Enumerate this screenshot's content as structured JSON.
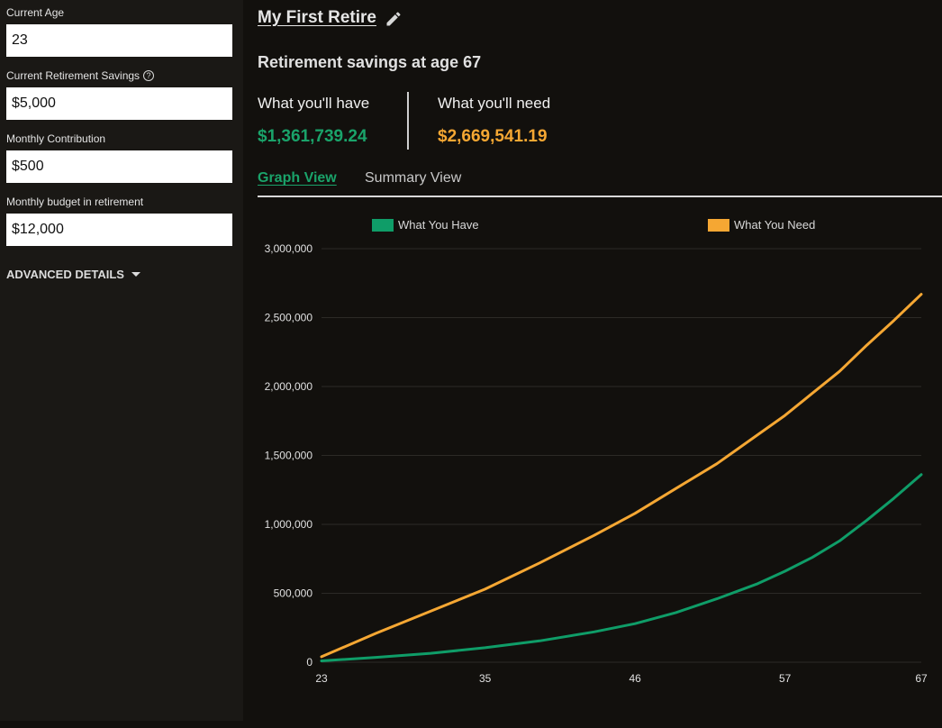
{
  "sidebar": {
    "fields": [
      {
        "label": "Current Age",
        "value": "23"
      },
      {
        "label": "Current Retirement Savings",
        "value": "$5,000",
        "help_icon": "question-circle-icon"
      },
      {
        "label": "Monthly Contribution",
        "value": "$500"
      },
      {
        "label": "Monthly budget in retirement",
        "value": "$12,000"
      }
    ],
    "advanced_label": "ADVANCED DETAILS"
  },
  "header": {
    "plan_name": "My First Retire",
    "edit_icon": "pencil-icon"
  },
  "summary": {
    "title": "Retirement savings at age 67",
    "have_label": "What you'll have",
    "have_value": "$1,361,739.24",
    "need_label": "What you'll need",
    "need_value": "$2,669,541.19"
  },
  "tabs": [
    {
      "label": "Graph View",
      "active": true
    },
    {
      "label": "Summary View",
      "active": false
    }
  ],
  "colors": {
    "have": "#0f9d68",
    "need": "#f5a733",
    "background": "#12100d"
  },
  "chart_data": {
    "type": "line",
    "x_ticks": [
      23,
      35,
      46,
      57,
      67
    ],
    "y_ticks": [
      "0",
      "500,000",
      "1,000,000",
      "1,500,000",
      "2,000,000",
      "2,500,000",
      "3,000,000"
    ],
    "ylim": [
      0,
      3000000
    ],
    "xlim": [
      23,
      67
    ],
    "legend_position": "top",
    "series": [
      {
        "name": "What You Have",
        "color": "#0f9d68",
        "x": [
          23,
          27,
          31,
          35,
          39,
          43,
          46,
          49,
          52,
          55,
          57,
          59,
          61,
          63,
          65,
          67
        ],
        "y": [
          10000,
          35000,
          65000,
          105000,
          155000,
          220000,
          280000,
          360000,
          460000,
          570000,
          660000,
          760000,
          880000,
          1030000,
          1190000,
          1361739
        ]
      },
      {
        "name": "What You Need",
        "color": "#f5a733",
        "x": [
          23,
          27,
          31,
          35,
          39,
          43,
          46,
          49,
          52,
          55,
          57,
          59,
          61,
          63,
          65,
          67
        ],
        "y": [
          40000,
          210000,
          370000,
          530000,
          720000,
          920000,
          1080000,
          1260000,
          1440000,
          1650000,
          1790000,
          1950000,
          2110000,
          2300000,
          2480000,
          2669541
        ]
      }
    ]
  }
}
